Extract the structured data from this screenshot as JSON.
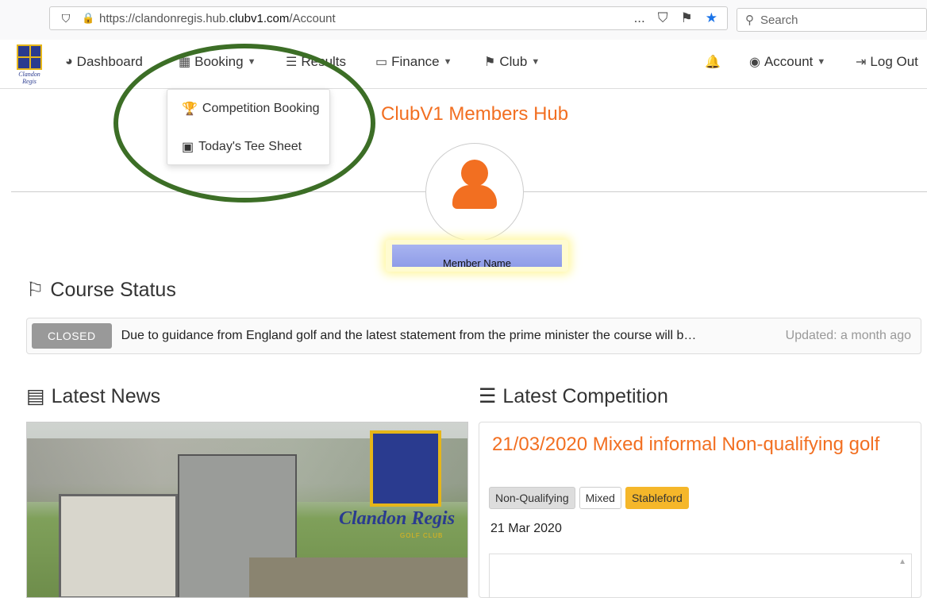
{
  "browser": {
    "url_prefix": "https://clandonregis.hub.",
    "url_host": "clubv1.com",
    "url_path": "/Account",
    "more_icon": "...",
    "search_placeholder": "Search"
  },
  "nav": {
    "logo_text": "Clandon Regis",
    "dashboard": "Dashboard",
    "booking": "Booking",
    "results": "Results",
    "finance": "Finance",
    "club": "Club",
    "account": "Account",
    "logout": "Log Out"
  },
  "booking_menu": {
    "items": [
      {
        "label": "Competition Booking",
        "icon": "trophy-icon"
      },
      {
        "label": "Today's Tee Sheet",
        "icon": "calendar-plus-icon"
      }
    ]
  },
  "hub": {
    "title": "ClubV1 Members Hub",
    "member_name": "Member Name"
  },
  "course_status": {
    "heading": "Course Status",
    "badge": "CLOSED",
    "message": "Due to guidance from England golf and the latest statement from the prime minister the course will b…",
    "updated": "Updated: a month ago"
  },
  "news": {
    "heading": "Latest News",
    "image_club_name": "Clandon Regis",
    "image_club_sub": "GOLF CLUB"
  },
  "competition": {
    "heading": "Latest Competition",
    "title": "21/03/2020 Mixed informal Non-qualifying golf",
    "tags": [
      "Non-Qualifying",
      "Mixed",
      "Stableford"
    ],
    "date": "21 Mar 2020"
  },
  "colors": {
    "accent": "#f26f21",
    "annotation": "#3c6e26",
    "closed_badge": "#999999",
    "stableford_tag": "#f5b72a"
  }
}
